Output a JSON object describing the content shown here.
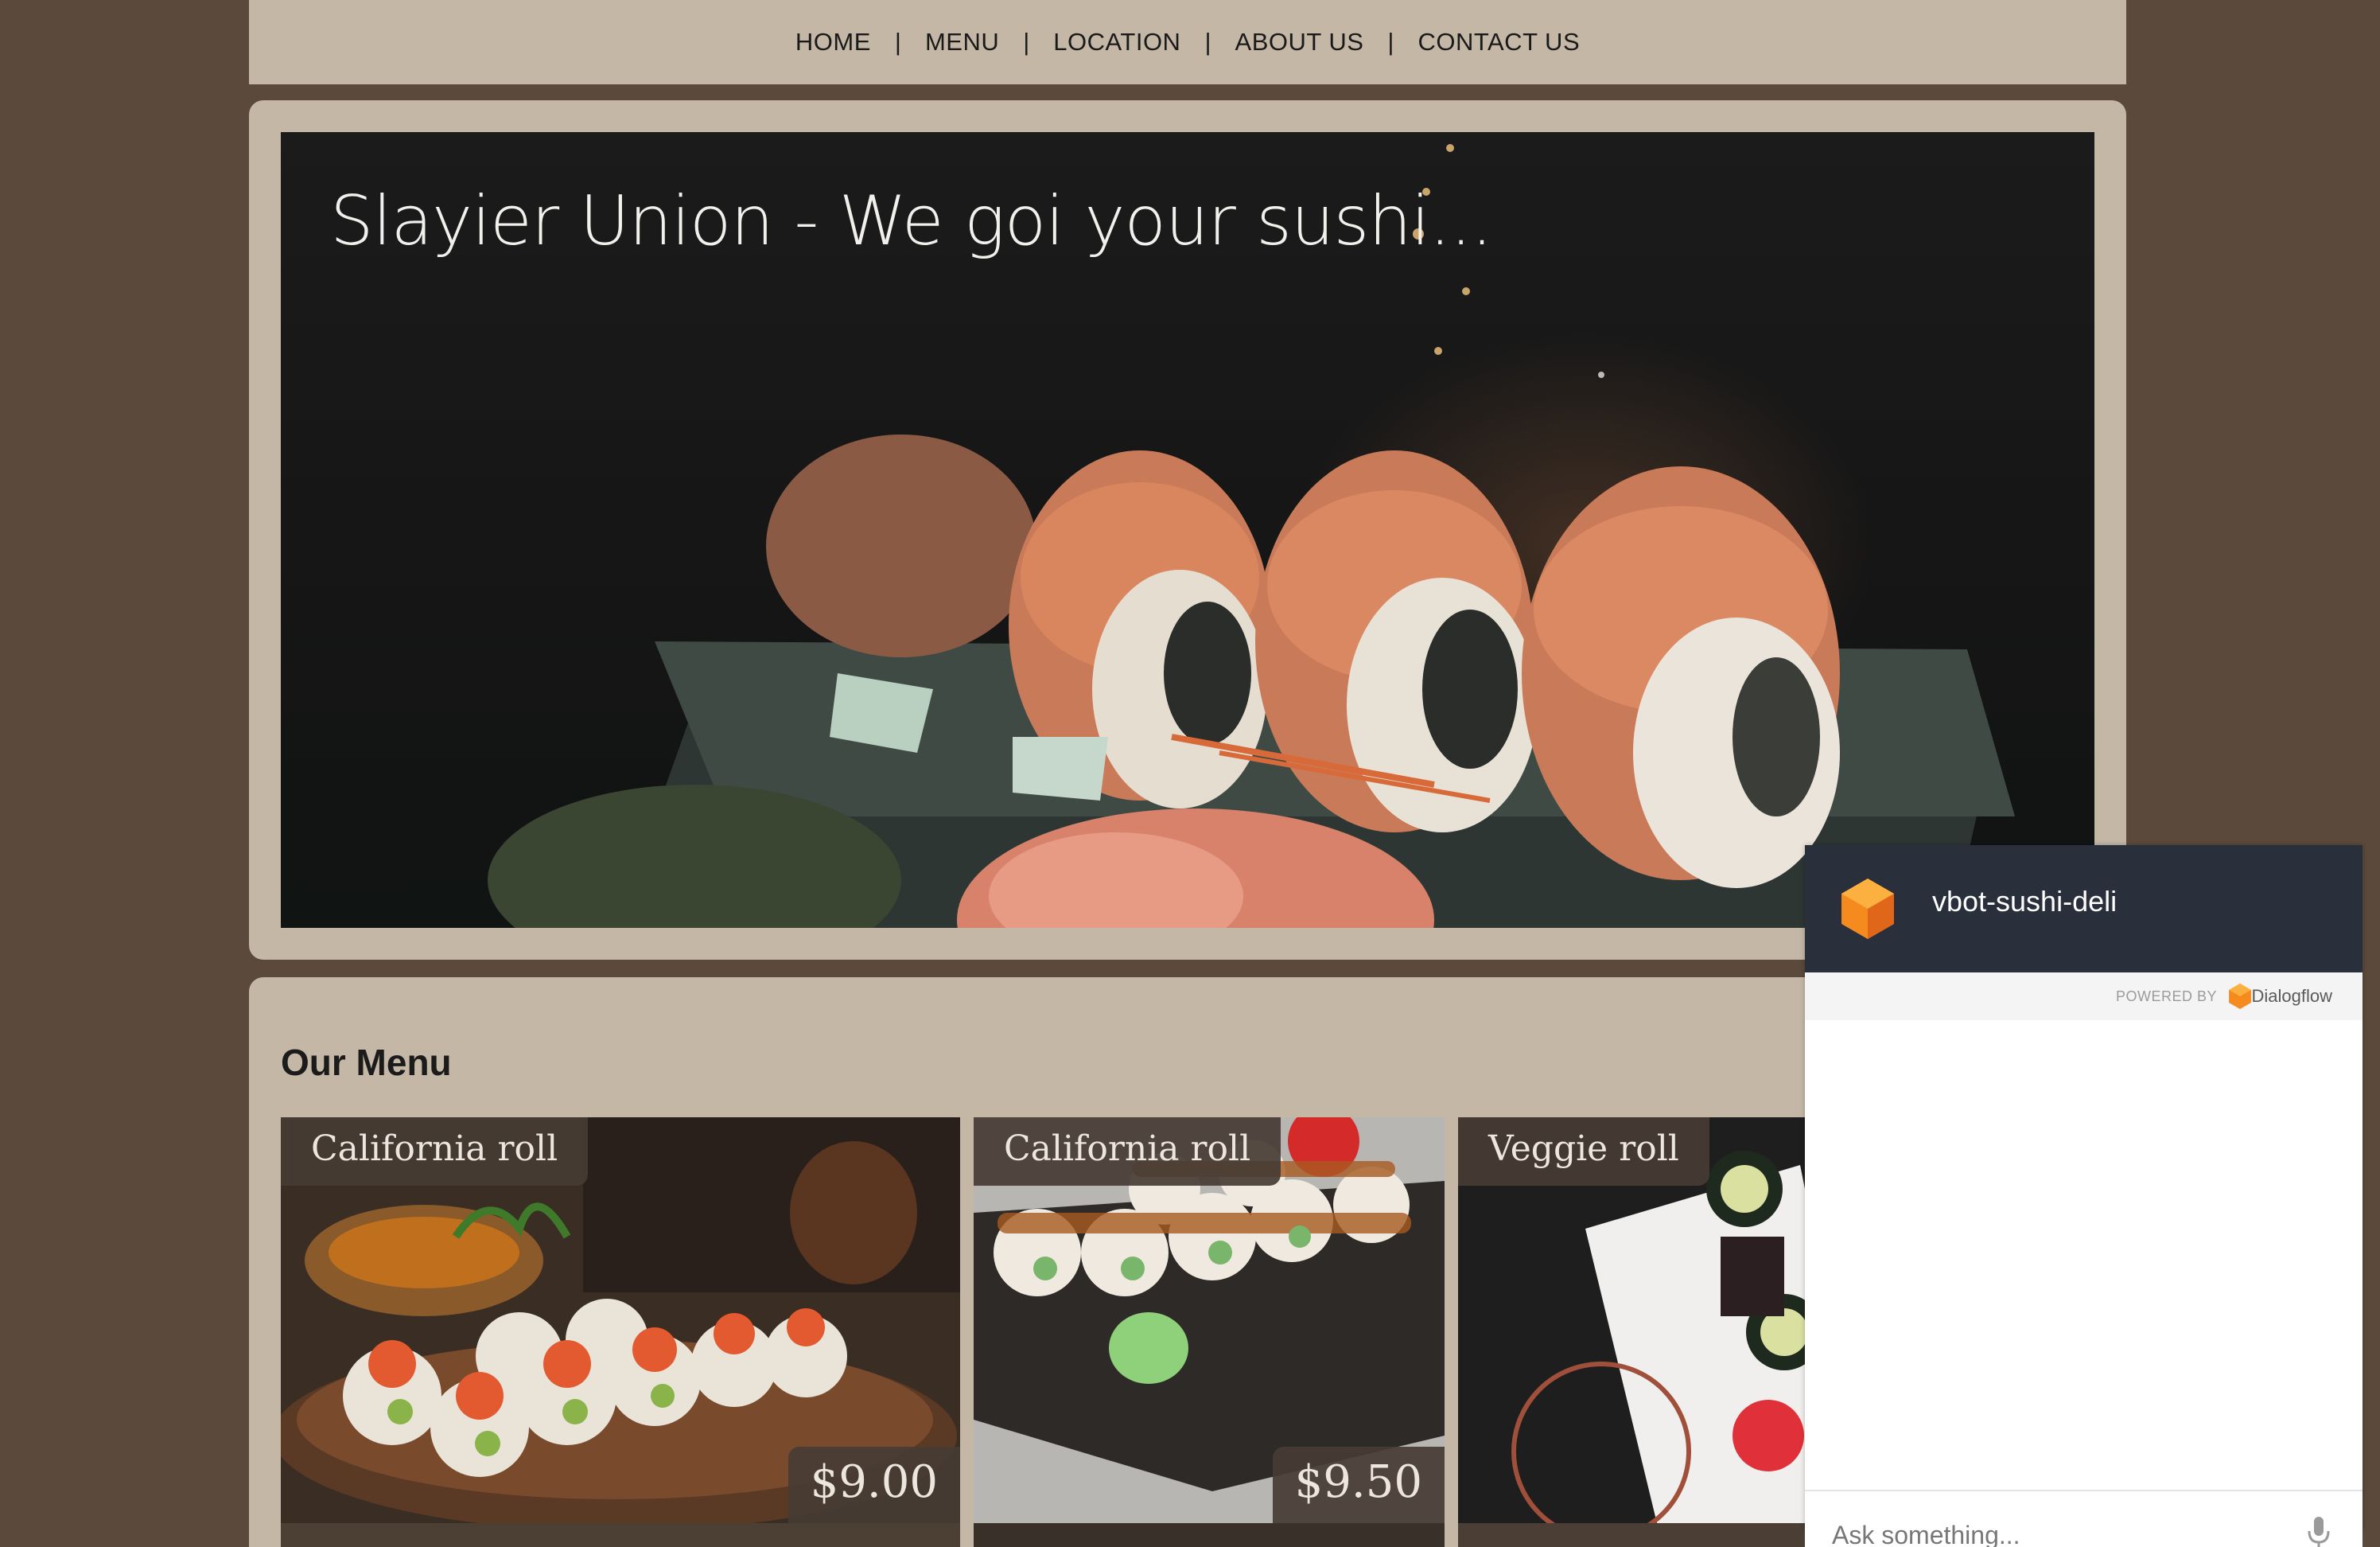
{
  "nav": {
    "items": [
      "HOME",
      "MENU",
      "LOCATION",
      "ABOUT US",
      "CONTACT US"
    ],
    "separator": "|"
  },
  "hero": {
    "title": "Slayier Union - We goi your sushi..."
  },
  "menu": {
    "heading": "Our Menu",
    "items": [
      {
        "name": "California roll",
        "price": "$9.00"
      },
      {
        "name": "California roll",
        "price": "$9.50"
      },
      {
        "name": "Veggie roll",
        "price": ""
      }
    ]
  },
  "chat": {
    "title": "vbot-sushi-deli",
    "powered_by": "POWERED BY",
    "provider": "Dialogflow",
    "input_placeholder": "Ask something...",
    "logo_icon": "dialogflow-icon",
    "mic_icon": "microphone-icon"
  },
  "colors": {
    "background": "#5b493b",
    "card": "#c4b7a6",
    "chat_header": "#2a2f3c",
    "dialogflow_orange": "#f58a1f"
  }
}
